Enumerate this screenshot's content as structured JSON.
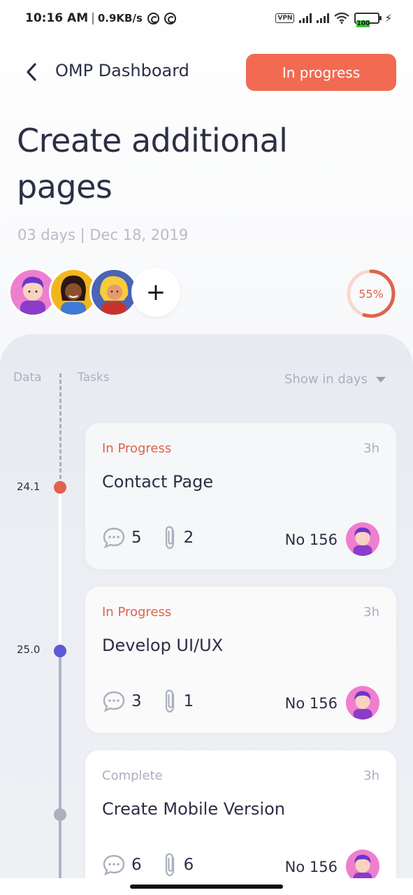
{
  "status_bar": {
    "time": "10:16 AM",
    "separator": "|",
    "network_speed": "0.9KB/s",
    "vpn_label": "VPN",
    "battery_level": "100"
  },
  "header": {
    "back_icon": "chevron-left-icon",
    "title": "OMP Dashboard",
    "status_button": "In progress"
  },
  "task": {
    "title": "Create additional pages",
    "meta": "03 days | Dec 18, 2019",
    "progress_label": "55%",
    "progress": 0.55,
    "add_member_symbol": "+"
  },
  "timeline": {
    "col_data": "Data",
    "col_tasks": "Tasks",
    "filter_label": "Show in days",
    "dates": [
      "24.1",
      "25.0"
    ]
  },
  "cards": [
    {
      "status": "In Progress",
      "duration": "3h",
      "title": "Contact Page",
      "comments": "5",
      "attachments": "2",
      "ticket": "No 156"
    },
    {
      "status": "In Progress",
      "duration": "3h",
      "title": "Develop UI/UX",
      "comments": "3",
      "attachments": "1",
      "ticket": "No 156"
    },
    {
      "status": "Complete",
      "duration": "3h",
      "title": "Create Mobile Version",
      "comments": "6",
      "attachments": "6",
      "ticket": "No 156"
    }
  ],
  "colors": {
    "accent": "#f26a52",
    "in_progress_text": "#e0624c",
    "complete_text": "#aab0bd",
    "dot_red": "#e0624c",
    "dot_blue": "#5b5bd6",
    "dot_grey": "#aab0bd",
    "title_text": "#2d2f45"
  }
}
